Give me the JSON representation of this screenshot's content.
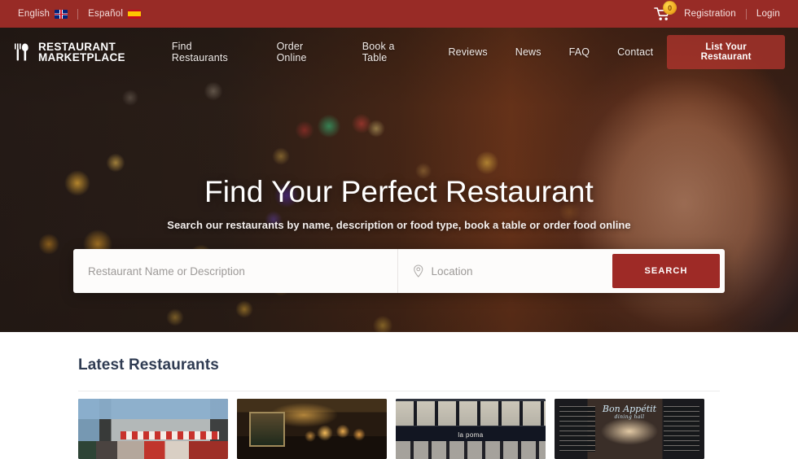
{
  "topbar": {
    "languages": [
      {
        "label": "English",
        "flag": "uk-flag-icon"
      },
      {
        "label": "Español",
        "flag": "spain-flag-icon"
      }
    ],
    "cart_icon": "shopping-cart-icon",
    "cart_count": "0",
    "registration_label": "Registration",
    "login_label": "Login",
    "background_color": "#982b26"
  },
  "navbar": {
    "logo_icon": "fork-knife-icon",
    "logo_line1": "RESTAURANT",
    "logo_line2": "MARKETPLACE",
    "links": [
      {
        "label": "Find Restaurants"
      },
      {
        "label": "Order Online"
      },
      {
        "label": "Book a Table"
      },
      {
        "label": "Reviews"
      },
      {
        "label": "News"
      },
      {
        "label": "FAQ"
      },
      {
        "label": "Contact"
      }
    ],
    "cta_label": "List Your Restaurant"
  },
  "hero": {
    "title": "Find Your Perfect Restaurant",
    "subtitle": "Search our restaurants by name, description or food type, book a table or order food online",
    "search": {
      "name_placeholder": "Restaurant Name or Description",
      "name_value": "",
      "location_icon": "map-pin-icon",
      "location_placeholder": "Location",
      "location_value": "",
      "button_label": "SEARCH",
      "button_color": "#9e2a26"
    }
  },
  "section": {
    "title": "Latest Restaurants",
    "title_color": "#2f3b52",
    "cards": [
      {
        "name": "street-restaurant-awning-photo"
      },
      {
        "name": "bar-interior-warm-lights-photo"
      },
      {
        "name": "la-poma-facade-photo",
        "caption": "la poma"
      },
      {
        "name": "bon-appetit-chalkboard-photo",
        "caption": "Bon Appétit",
        "caption_sub": "dining hall"
      }
    ]
  }
}
